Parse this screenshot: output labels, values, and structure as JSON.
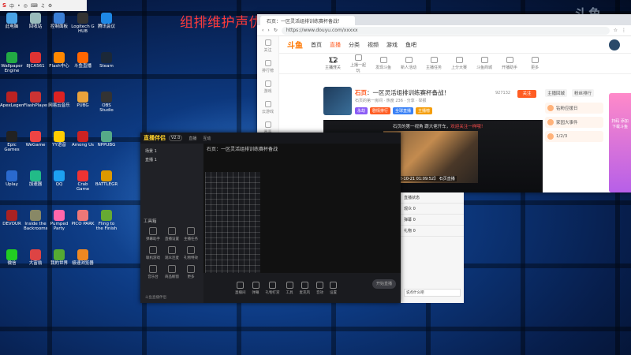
{
  "overlay": {
    "title": "组排维护声优：Anlianpwd"
  },
  "watermark": {
    "text": "斗鱼"
  },
  "taskbar": {
    "logo": "S",
    "labels": [
      "中",
      "•",
      "◎",
      "⌨",
      "♫",
      "⚙"
    ]
  },
  "desktop_icons": [
    {
      "label": "此电脑",
      "color": "#4aa3e6"
    },
    {
      "label": "回收站",
      "color": "#9bb"
    },
    {
      "label": "控制面板",
      "color": "#3b7fd6"
    },
    {
      "label": "Logitech G HUB",
      "color": "#333"
    },
    {
      "label": "腾讯会议",
      "color": "#1e88e5"
    },
    {
      "label": "Wallpaper Engine",
      "color": "#2a4"
    },
    {
      "label": "8JCA561",
      "color": "#d33"
    },
    {
      "label": "Flash中心",
      "color": "#f80"
    },
    {
      "label": "斗鱼直播",
      "color": "#f60"
    },
    {
      "label": "Steam",
      "color": "#1b2838"
    },
    {
      "label": "ApexLegends",
      "color": "#b22"
    },
    {
      "label": "FlashPlayer",
      "color": "#c33"
    },
    {
      "label": "网易云音乐",
      "color": "#d22"
    },
    {
      "label": "PUBG",
      "color": "#e9a23b"
    },
    {
      "label": "OBS Studio",
      "color": "#333"
    },
    {
      "label": "Epic Games",
      "color": "#222"
    },
    {
      "label": "WeGame",
      "color": "#e44"
    },
    {
      "label": "YY语音",
      "color": "#fc0"
    },
    {
      "label": "Among Us",
      "color": "#c22"
    },
    {
      "label": "NPPUBG",
      "color": "#5a8"
    },
    {
      "label": "Uplay",
      "color": "#2a6acf"
    },
    {
      "label": "加速器",
      "color": "#2b8"
    },
    {
      "label": "QQ",
      "color": "#1da1f2"
    },
    {
      "label": "Crab Game",
      "color": "#e33"
    },
    {
      "label": "BATTLEGR",
      "color": "#d90"
    },
    {
      "label": "DEVOUR",
      "color": "#a22"
    },
    {
      "label": "Inside the Backrooms",
      "color": "#886"
    },
    {
      "label": "Pumped Party",
      "color": "#f6a"
    },
    {
      "label": "PICO PARK",
      "color": "#e77"
    },
    {
      "label": "Fling to the Finish",
      "color": "#6a3"
    },
    {
      "label": "微信",
      "color": "#2c2"
    },
    {
      "label": "大富翁",
      "color": "#d44"
    },
    {
      "label": "我的世界",
      "color": "#5a3"
    },
    {
      "label": "极速浏览器",
      "color": "#e82"
    }
  ],
  "browser": {
    "tab_title": "石页：一区灵活组排训练赛杯备战！",
    "url": "https://www.douyu.com/xxxxx",
    "logo": "斗鱼",
    "nav": [
      "首页",
      "直播",
      "分类",
      "视频",
      "游戏",
      "鱼吧"
    ],
    "sidebar": [
      "关注",
      "排行榜",
      "游戏",
      "云游戏",
      "赛事",
      "鱼吧"
    ],
    "count": {
      "value": "12",
      "label": "关注"
    },
    "tools": [
      "主播开关",
      "上播一起玩",
      "发现斗鱼",
      "新人活动",
      "主播任务",
      "上分大赛",
      "斗鱼商城",
      "开播助手",
      "更多"
    ],
    "room": {
      "host": "石页",
      "title": "一区灵活组排训练赛杯备战！",
      "meta": "石页的第一房间 · 热度 236 · 分享 · 举报",
      "follow": "关注",
      "followers": "927132",
      "tags": [
        "永劫",
        "剧情排行",
        "全球直播",
        "主播榜"
      ]
    },
    "video": {
      "caption": "石页的第一视角 跟大佬开车，",
      "caption_hi": "欢迎关注一样哦！",
      "stamp": "【2022-10-21 01:09:52】 石页直播",
      "btn": "弹幕"
    },
    "rank": {
      "tabs": [
        "主播回城",
        "粉丝排行"
      ],
      "rows": [
        "钻粉应援日",
        "家园大事件",
        "1/2/3"
      ]
    },
    "promo": "扫码 添加 下载斗鱼"
  },
  "obs": {
    "logo": "直播伴侣",
    "badge": "V2.0",
    "tabs": [
      "直播",
      "互动"
    ],
    "scenes": [
      "场景 1",
      "直播 1"
    ],
    "stage_title": "石页：一区灵活组排训练赛杯备战",
    "tools_title": "工具箱",
    "tools": [
      "弹幕助手",
      "直播设置",
      "主播任务",
      "联机游戏",
      "观众连麦",
      "礼物特效",
      "音乐台",
      "商品橱窗",
      "更多"
    ],
    "bottom": [
      "直播间",
      "弹幕",
      "礼物打赏",
      "工具",
      "麦克风",
      "音效",
      "设置"
    ],
    "start": "开始直播",
    "footer": "斗鱼直播伴侣"
  },
  "right_panel": {
    "rows": [
      "直播状态",
      "观众 0",
      "弹幕 0",
      "礼物 0"
    ],
    "input": "说点什么吧"
  }
}
